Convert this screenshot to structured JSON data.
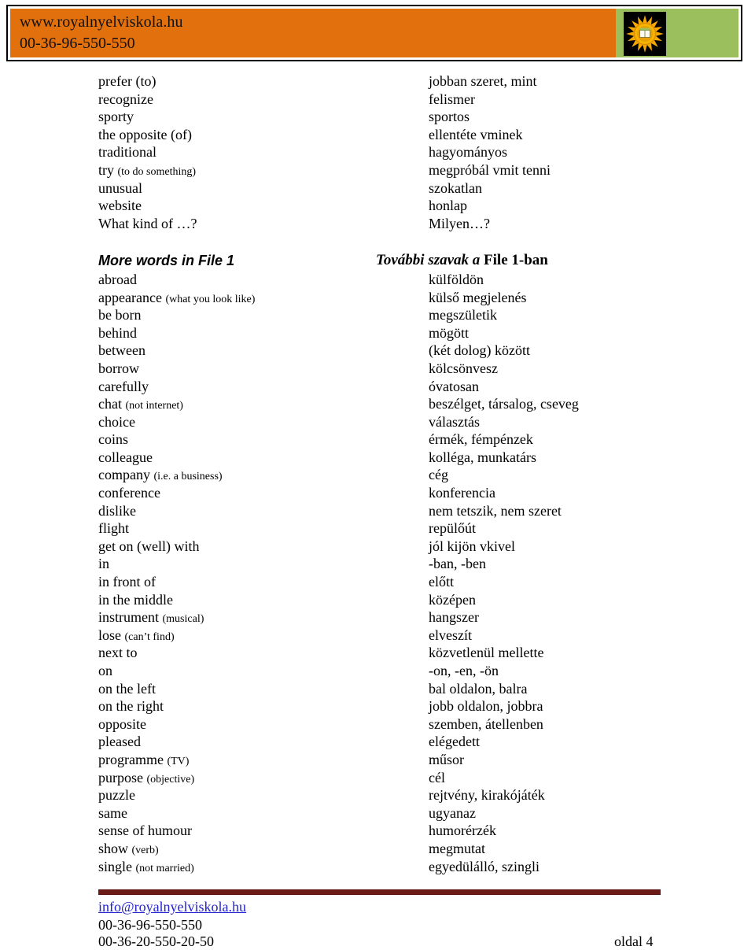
{
  "header": {
    "site_url": "www.royalnyelviskola.hu",
    "phone": "00-36-96-550-550",
    "logo_name": "sun-crown-logo",
    "orange_hex": "#E2700D",
    "green_hex": "#9CBF5E"
  },
  "top_list": [
    {
      "en": "prefer (to)",
      "note": "",
      "hu": "jobban szeret, mint"
    },
    {
      "en": "recognize",
      "note": "",
      "hu": "felismer"
    },
    {
      "en": "sporty",
      "note": "",
      "hu": "sportos"
    },
    {
      "en": "the opposite (of)",
      "note": "",
      "hu": "ellentéte vminek"
    },
    {
      "en": "traditional",
      "note": "",
      "hu": "hagyományos"
    },
    {
      "en": "try ",
      "note": "(to do something)",
      "hu": "megpróbál vmit tenni"
    },
    {
      "en": "unusual",
      "note": "",
      "hu": "szokatlan"
    },
    {
      "en": "website",
      "note": "",
      "hu": "honlap"
    },
    {
      "en": "What kind of …?",
      "note": "",
      "hu": "Milyen…?"
    }
  ],
  "section": {
    "en_heading": "More words in File 1",
    "hu_heading_italic": "További szavak a ",
    "hu_heading_roman": "File 1-ban"
  },
  "main_list": [
    {
      "en": "abroad",
      "note": "",
      "hu": "külföldön"
    },
    {
      "en": "appearance ",
      "note": "(what you look like)",
      "hu": "külső megjelenés"
    },
    {
      "en": "be born",
      "note": "",
      "hu": "megszületik"
    },
    {
      "en": "behind",
      "note": "",
      "hu": "mögött"
    },
    {
      "en": "between",
      "note": "",
      "hu": "(két dolog) között"
    },
    {
      "en": "borrow",
      "note": "",
      "hu": "kölcsönvesz"
    },
    {
      "en": "carefully",
      "note": "",
      "hu": "óvatosan"
    },
    {
      "en": "chat ",
      "note": "(not internet)",
      "hu": "beszélget, társalog, cseveg"
    },
    {
      "en": "choice",
      "note": "",
      "hu": "választás"
    },
    {
      "en": "coins",
      "note": "",
      "hu": "érmék, fémpénzek"
    },
    {
      "en": "colleague",
      "note": "",
      "hu": "kolléga, munkatárs"
    },
    {
      "en": "company ",
      "note": "(i.e. a business)",
      "hu": "cég"
    },
    {
      "en": "conference",
      "note": "",
      "hu": "konferencia"
    },
    {
      "en": "dislike",
      "note": "",
      "hu": "nem tetszik, nem szeret"
    },
    {
      "en": "flight",
      "note": "",
      "hu": "repülőút"
    },
    {
      "en": "get on (well) with",
      "note": "",
      "hu": "jól kijön vkivel"
    },
    {
      "en": "in",
      "note": "",
      "hu": "-ban, -ben"
    },
    {
      "en": "in front of",
      "note": "",
      "hu": "előtt"
    },
    {
      "en": "in the middle",
      "note": "",
      "hu": "középen"
    },
    {
      "en": "instrument ",
      "note": "(musical)",
      "hu": "hangszer"
    },
    {
      "en": "lose ",
      "note": "(can’t find)",
      "hu": "elveszít"
    },
    {
      "en": "next to",
      "note": "",
      "hu": "közvetlenül mellette"
    },
    {
      "en": "on",
      "note": "",
      "hu": "-on, -en, -ön"
    },
    {
      "en": "on the left",
      "note": "",
      "hu": "bal oldalon, balra"
    },
    {
      "en": "on the right",
      "note": "",
      "hu": "jobb oldalon, jobbra"
    },
    {
      "en": "opposite",
      "note": "",
      "hu": "szemben, átellenben"
    },
    {
      "en": "pleased",
      "note": "",
      "hu": "elégedett"
    },
    {
      "en": "programme ",
      "note": "(TV)",
      "hu": "műsor"
    },
    {
      "en": "purpose ",
      "note": "(objective)",
      "hu": "cél"
    },
    {
      "en": "puzzle",
      "note": "",
      "hu": "rejtvény, kirakójáték"
    },
    {
      "en": "same",
      "note": "",
      "hu": "ugyanaz"
    },
    {
      "en": "sense of humour",
      "note": "",
      "hu": "humorérzék"
    },
    {
      "en": "show ",
      "note": "(verb)",
      "hu": "megmutat"
    },
    {
      "en": "single ",
      "note": "(not married)",
      "hu": "egyedülálló, szingli"
    }
  ],
  "footer": {
    "email": "info@royalnyelviskola.hu",
    "phone1": "00-36-96-550-550",
    "phone2": "00-36-20-550-20-50",
    "page_label": "oldal 4",
    "rule_hex": "#6B1A17",
    "link_hex": "#2222CC"
  }
}
